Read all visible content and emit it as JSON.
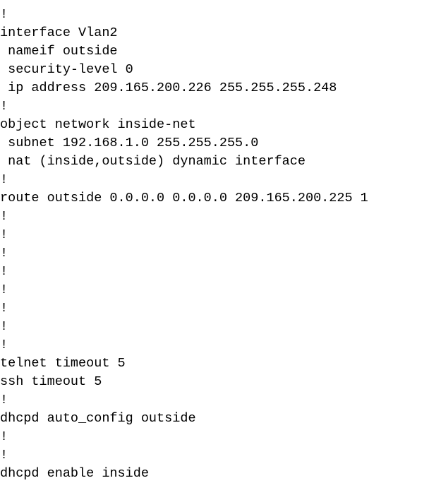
{
  "config": {
    "lines": [
      "!",
      "!",
      "interface Vlan2",
      " nameif outside",
      " security-level 0",
      " ip address 209.165.200.226 255.255.255.248",
      "!",
      "object network inside-net",
      " subnet 192.168.1.0 255.255.255.0",
      " nat (inside,outside) dynamic interface",
      "!",
      "route outside 0.0.0.0 0.0.0.0 209.165.200.225 1",
      "!",
      "!",
      "!",
      "!",
      "!",
      "!",
      "!",
      "!",
      "telnet timeout 5",
      "ssh timeout 5",
      "!",
      "dhcpd auto_config outside",
      "!",
      "!",
      "dhcpd enable inside"
    ]
  }
}
